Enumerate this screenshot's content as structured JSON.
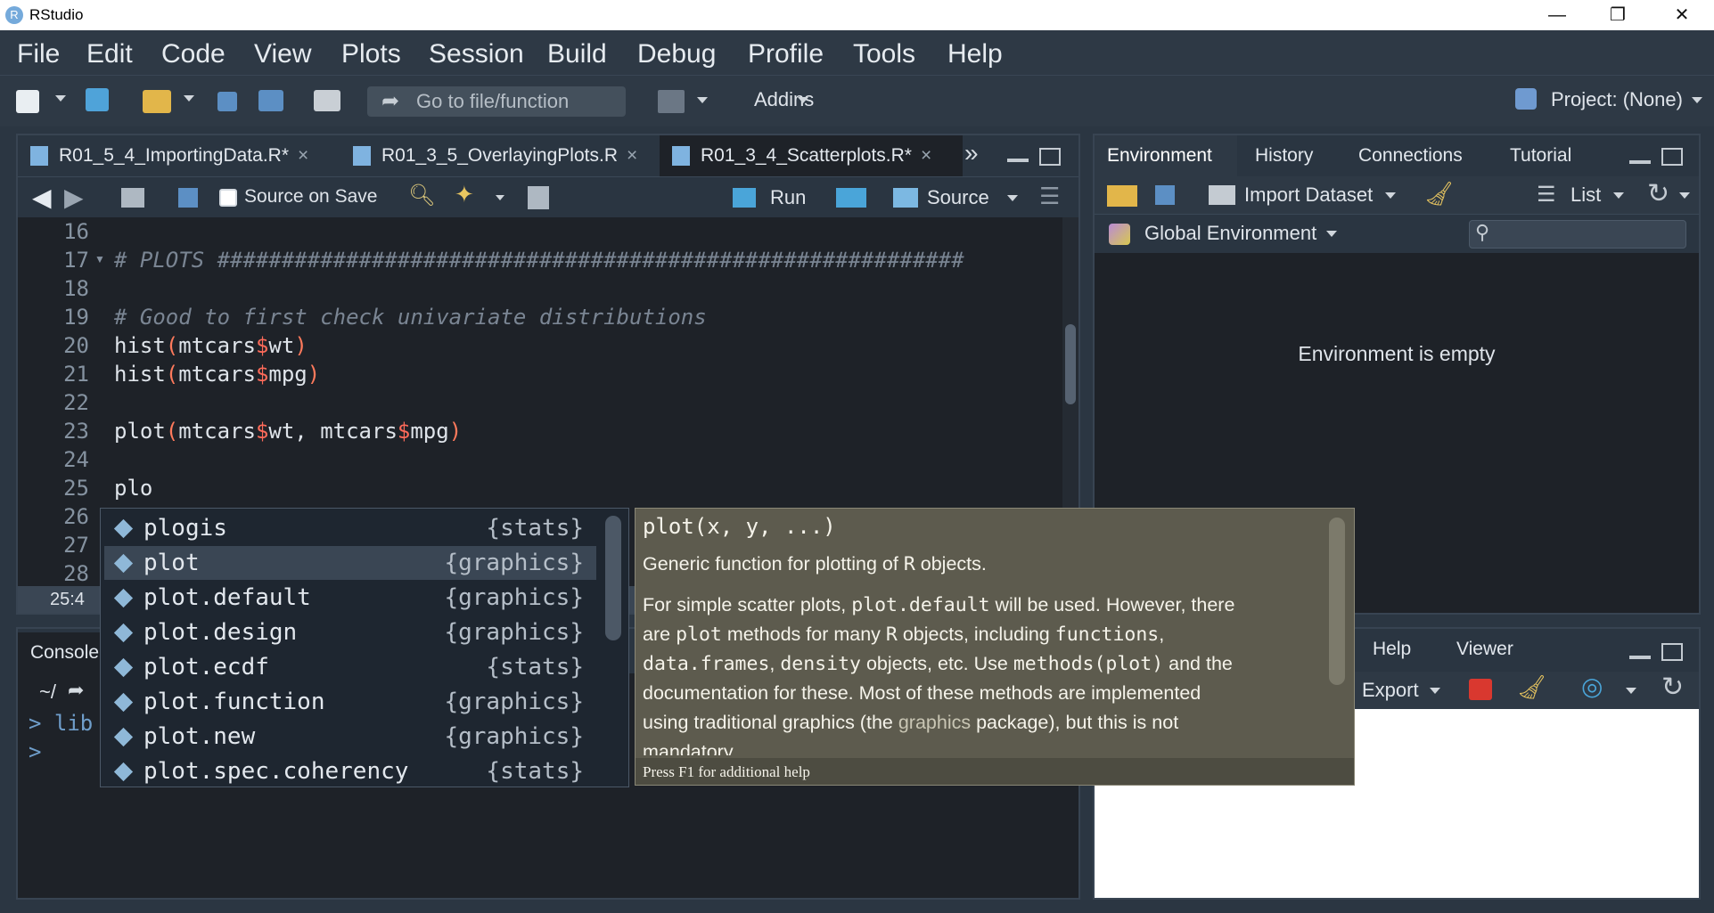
{
  "window": {
    "title": "RStudio",
    "logo": "R",
    "min_glyph": "—",
    "restore_glyph": "❐",
    "close_glyph": "✕"
  },
  "menu": [
    "File",
    "Edit",
    "Code",
    "View",
    "Plots",
    "Session",
    "Build",
    "Debug",
    "Profile",
    "Tools",
    "Help"
  ],
  "toolbar": {
    "goto_placeholder": "Go to file/function",
    "addins": "Addins",
    "project": "Project: (None)"
  },
  "editor": {
    "tabs": [
      "R01_5_4_ImportingData.R*",
      "R01_3_5_OverlayingPlots.R",
      "R01_3_4_Scatterplots.R*"
    ],
    "source_on_save": "Source on Save",
    "run": "Run",
    "source": "Source",
    "position": "25:4",
    "lines": [
      "16",
      "17",
      "18",
      "19",
      "20",
      "21",
      "22",
      "23",
      "24",
      "25",
      "26",
      "27",
      "28"
    ],
    "code": {
      "l17": "# PLOTS ##########################################################",
      "l19": "# Good to first check univariate distributions",
      "l20a": "hist",
      "l20b": "mtcars",
      "l20c": "wt",
      "l21a": "hist",
      "l21b": "mtcars",
      "l21c": "mpg",
      "l23a": "plot",
      "l23b": "mtcars",
      "l23c": "wt, mtcars",
      "l23d": "mpg",
      "l25": "plo"
    }
  },
  "environment": {
    "tabs": [
      "Environment",
      "History",
      "Connections",
      "Tutorial"
    ],
    "import_dataset": "Import Dataset",
    "list": "List",
    "scope": "Global Environment",
    "empty": "Environment is empty"
  },
  "console": {
    "tab": "Console",
    "path": "~/",
    "line1": "> lib",
    "line2": ">"
  },
  "files": {
    "tabs": [
      "Help",
      "Viewer"
    ],
    "export": "Export"
  },
  "autocomplete": [
    {
      "name": "plogis",
      "pkg": "{stats}"
    },
    {
      "name": "plot",
      "pkg": "{graphics}"
    },
    {
      "name": "plot.default",
      "pkg": "{graphics}"
    },
    {
      "name": "plot.design",
      "pkg": "{graphics}"
    },
    {
      "name": "plot.ecdf",
      "pkg": "{stats}"
    },
    {
      "name": "plot.function",
      "pkg": "{graphics}"
    },
    {
      "name": "plot.new",
      "pkg": "{graphics}"
    },
    {
      "name": "plot.spec.coherency",
      "pkg": "{stats}"
    }
  ],
  "help": {
    "signature": "plot(x, y, ...)",
    "p1a": "Generic function for plotting of",
    "p1b": "R",
    "p1c": "objects.",
    "p2_1a": "For simple scatter plots,",
    "p2_1b": "plot.default",
    "p2_1c": "will be used. However, there",
    "p2_2a": "are",
    "p2_2b": "plot",
    "p2_2c": "methods for many",
    "p2_2d": "R",
    "p2_2e": "objects, including",
    "p2_2f": "functions",
    "p2_3a": "data.frames",
    "p2_3b": "density",
    "p2_3c": "objects, etc. Use",
    "p2_3d": "methods(plot)",
    "p2_3e": "and the",
    "p2_4": "documentation for these. Most of these methods are implemented",
    "p2_5a": "using traditional graphics (the",
    "p2_5b": "graphics",
    "p2_5c": "package), but this is not",
    "p2_6": "mandatory.",
    "footer": "Press F1 for additional help"
  }
}
